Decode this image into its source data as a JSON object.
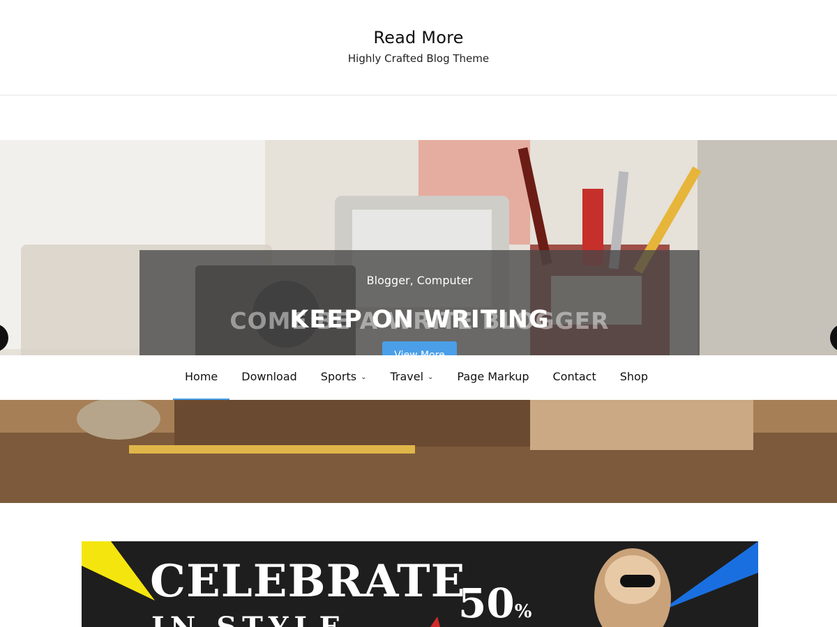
{
  "site": {
    "title": "Read More",
    "tagline": "Highly Crafted Blog Theme"
  },
  "slider": {
    "categories": "Blogger, Computer",
    "title": "KEEP ON WRITING",
    "ghost_title": "COME BE A WRITE BLOGGER",
    "button_label": "View More"
  },
  "nav": {
    "items": [
      {
        "label": "Home",
        "active": true,
        "has_submenu": false
      },
      {
        "label": "Download",
        "active": false,
        "has_submenu": false
      },
      {
        "label": "Sports",
        "active": false,
        "has_submenu": true
      },
      {
        "label": "Travel",
        "active": false,
        "has_submenu": true
      },
      {
        "label": "Page Markup",
        "active": false,
        "has_submenu": false
      },
      {
        "label": "Contact",
        "active": false,
        "has_submenu": false
      },
      {
        "label": "Shop",
        "active": false,
        "has_submenu": false
      }
    ]
  },
  "banner": {
    "title": "CELEBRATE",
    "subtitle": "IN STYLE",
    "discount_value": "50",
    "discount_unit": "%"
  },
  "colors": {
    "accent": "#4a9fe8",
    "caption_bg": "#464646",
    "banner_bg": "#1e1e1e",
    "banner_yellow": "#f5e50f",
    "banner_blue": "#1a6fe0"
  },
  "icons": {
    "prev": "chevron-left-icon",
    "next": "chevron-right-icon",
    "submenu": "chevron-down-icon"
  }
}
